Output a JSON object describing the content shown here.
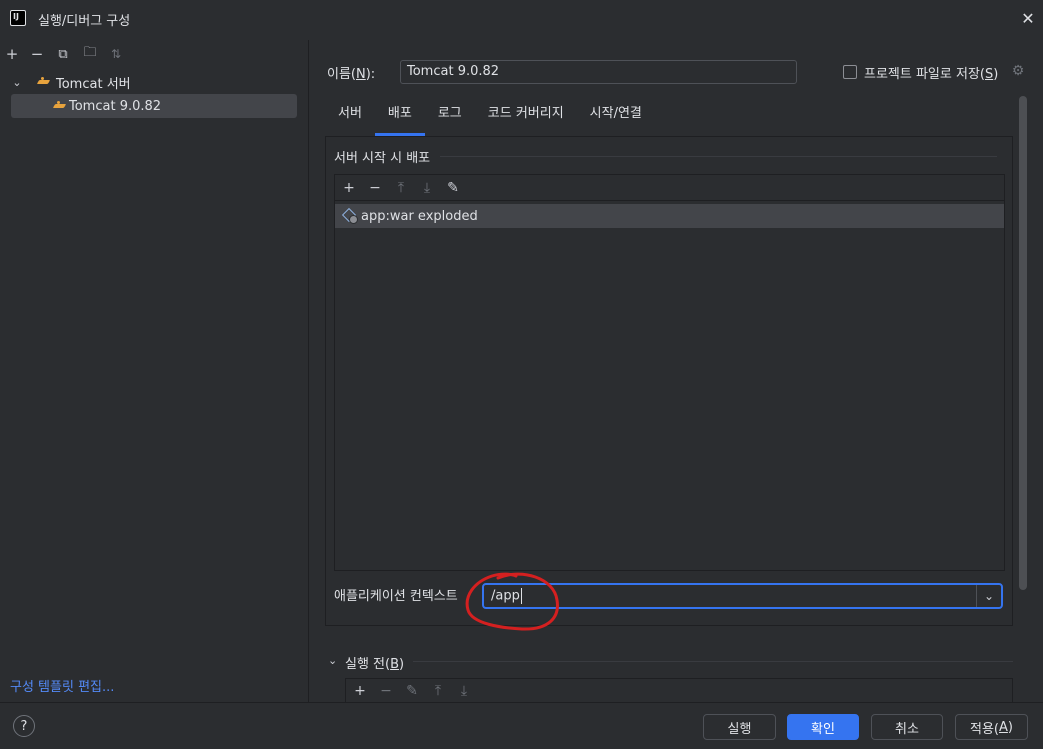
{
  "window": {
    "app_icon_text": "IJ",
    "title": "실행/디버그 구성",
    "close_glyph": "✕"
  },
  "left_panel": {
    "toolbar": [
      {
        "name": "add-icon",
        "glyph": "+"
      },
      {
        "name": "remove-icon",
        "glyph": "−"
      },
      {
        "name": "copy-icon",
        "glyph": "⧉"
      },
      {
        "name": "new-folder-icon",
        "glyph": "🗀"
      },
      {
        "name": "sort-icon",
        "glyph": "⇅"
      }
    ],
    "tree": {
      "root_label": "Tomcat 서버",
      "root_chevron": "⌄",
      "child_label": "Tomcat 9.0.82"
    },
    "edit_templates_link": "구성 템플릿 편집..."
  },
  "header": {
    "name_label_prefix": "이름(",
    "name_label_mnemonic": "N",
    "name_label_suffix": "):",
    "name_value": "Tomcat 9.0.82",
    "store_as_file_prefix": "프로젝트 파일로 저장(",
    "store_as_file_mnemonic": "S",
    "store_as_file_suffix": ")",
    "store_as_file_checked": false,
    "gear_glyph": "⚙"
  },
  "tabs": [
    {
      "label": "서버",
      "active": false
    },
    {
      "label": "배포",
      "active": true
    },
    {
      "label": "로그",
      "active": false
    },
    {
      "label": "코드 커버리지",
      "active": false
    },
    {
      "label": "시작/연결",
      "active": false
    }
  ],
  "deployment": {
    "section_title": "서버 시작 시 배포",
    "toolbar": [
      {
        "name": "add-icon",
        "glyph": "+",
        "enabled": true
      },
      {
        "name": "remove-icon",
        "glyph": "−",
        "enabled": true
      },
      {
        "name": "move-up-icon",
        "glyph": "⤒",
        "enabled": false
      },
      {
        "name": "move-down-icon",
        "glyph": "⤓",
        "enabled": false
      },
      {
        "name": "edit-icon",
        "glyph": "✎",
        "enabled": true
      }
    ],
    "artifacts": [
      "app:war exploded"
    ],
    "app_context_label": "애플리케이션 컨텍스트",
    "app_context_value": "/app",
    "dropdown_glyph": "⌄"
  },
  "before_launch": {
    "chevron": "⌄",
    "label_prefix": "실행 전(",
    "label_mnemonic": "B",
    "label_suffix": ")",
    "toolbar": [
      {
        "name": "add-icon",
        "glyph": "+",
        "enabled": true
      },
      {
        "name": "remove-icon",
        "glyph": "−",
        "enabled": false
      },
      {
        "name": "edit-icon",
        "glyph": "✎",
        "enabled": false
      },
      {
        "name": "move-up-icon",
        "glyph": "⤒",
        "enabled": false
      },
      {
        "name": "move-down-icon",
        "glyph": "⤓",
        "enabled": false
      }
    ]
  },
  "footer": {
    "help_glyph": "?",
    "run_label": "실행",
    "ok_label": "확인",
    "cancel_label": "취소",
    "apply_prefix": "적용(",
    "apply_mnemonic": "A",
    "apply_suffix": ")"
  },
  "colors": {
    "background": "#2b2d30",
    "accent": "#3574f0",
    "link": "#548af7",
    "selection": "#43454a",
    "annotation": "#d42020"
  }
}
